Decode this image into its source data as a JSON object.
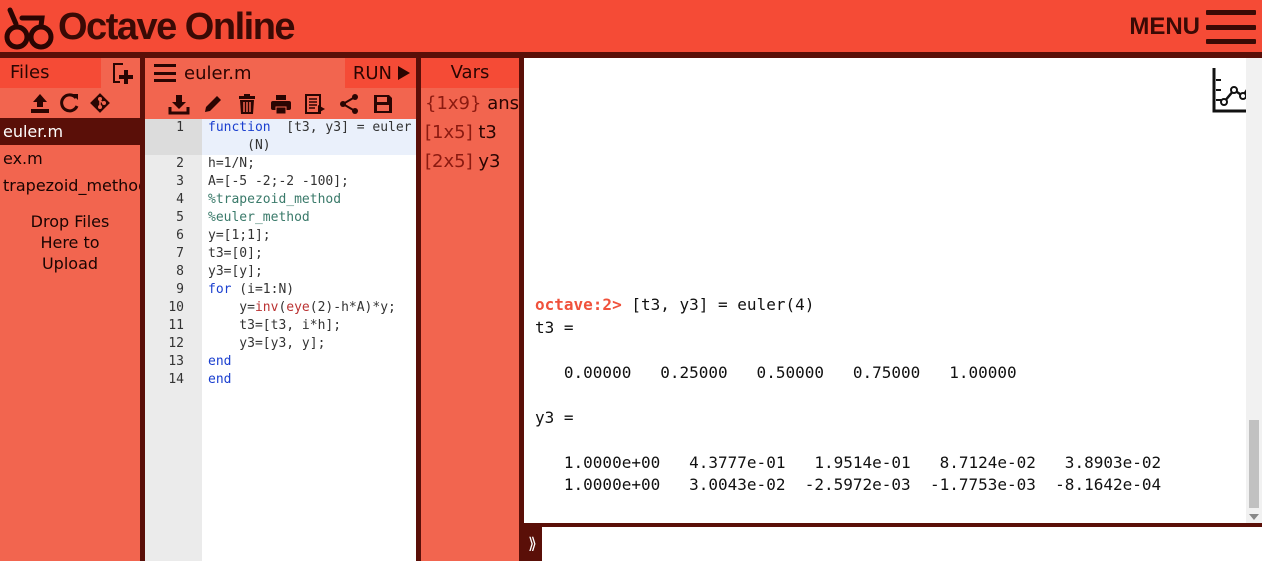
{
  "header": {
    "app_title": "Octave Online",
    "menu_label": "MENU"
  },
  "files": {
    "title": "Files",
    "items": [
      {
        "name": "euler.m",
        "active": true
      },
      {
        "name": "ex.m",
        "active": false
      },
      {
        "name": "trapezoid_method.m",
        "active": false
      }
    ],
    "drop_hint_lines": [
      "Drop Files",
      "Here to",
      "Upload"
    ]
  },
  "editor": {
    "filename": "euler.m",
    "run_label": "RUN",
    "line_numbers": [
      "1",
      "2",
      "3",
      "4",
      "5",
      "6",
      "7",
      "8",
      "9",
      "10",
      "11",
      "12",
      "13",
      "14"
    ]
  },
  "vars": {
    "title": "Vars",
    "items": [
      {
        "dim": "{1x9}",
        "name": "ans"
      },
      {
        "dim": "[1x5]",
        "name": "t3"
      },
      {
        "dim": "[2x5]",
        "name": "y3"
      }
    ]
  },
  "console": {
    "prompt": "octave:2>",
    "command": " [t3, y3] = euler(4)",
    "lines": [
      "t3 =",
      "",
      "   0.00000   0.25000   0.50000   0.75000   1.00000",
      "",
      "y3 =",
      "",
      "   1.0000e+00   4.3777e-01   1.9514e-01   8.7124e-02   3.8903e-02",
      "   1.0000e+00   3.0043e-02  -2.5972e-03  -1.7753e-03  -8.1642e-04"
    ],
    "input_value": "",
    "prompt_icon": "⟫"
  },
  "colors": {
    "primary": "#f54b36",
    "panel": "#f2654f",
    "dark": "#5a0f08",
    "prompt": "#f0523c"
  },
  "icons": [
    "logo-icon",
    "menu-icon",
    "new-file-icon",
    "upload-icon",
    "refresh-icon",
    "git-icon",
    "download-icon",
    "pencil-icon",
    "trash-icon",
    "print-icon",
    "share-file-icon",
    "share-icon",
    "save-icon",
    "plot-icon"
  ]
}
